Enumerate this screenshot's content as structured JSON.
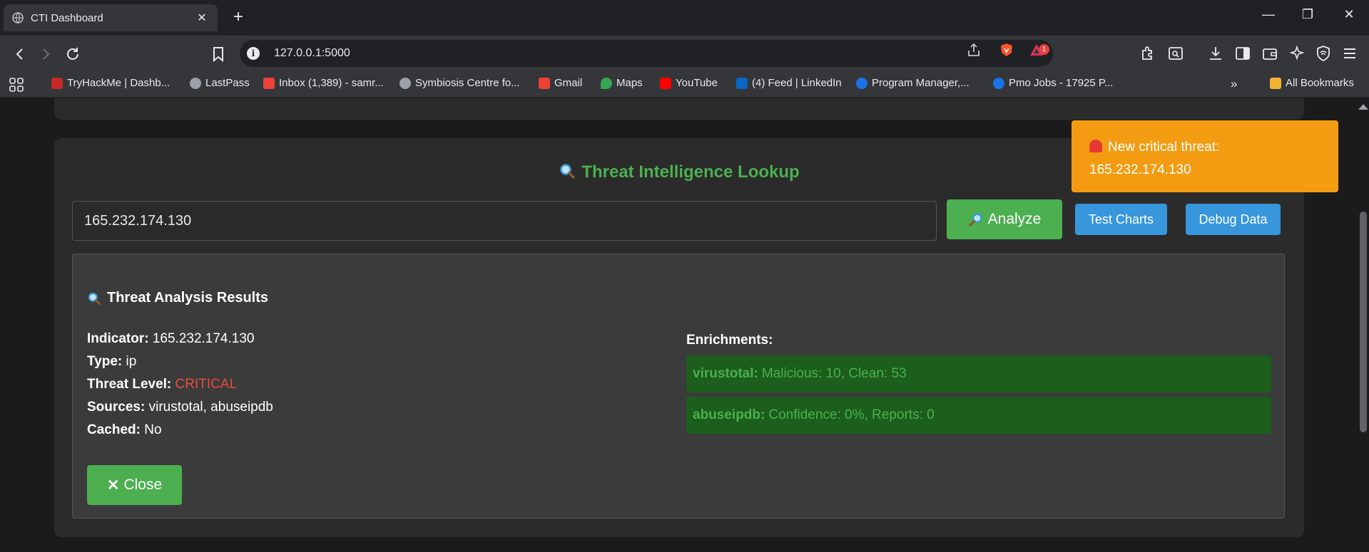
{
  "browser": {
    "tab_title": "CTI Dashboard",
    "url": "127.0.0.1:5000",
    "notification_count": "1",
    "bookmarks": [
      {
        "label": "TryHackMe | Dashb...",
        "color": "#c62828"
      },
      {
        "label": "LastPass",
        "color": "#9aa0a6"
      },
      {
        "label": "Inbox (1,389) - samr...",
        "color": "#ea4335"
      },
      {
        "label": "Symbiosis Centre fo...",
        "color": "#9aa0a6"
      },
      {
        "label": "Gmail",
        "color": "#ea4335"
      },
      {
        "label": "Maps",
        "color": "#34a853"
      },
      {
        "label": "YouTube",
        "color": "#ff0000"
      },
      {
        "label": "(4) Feed | LinkedIn",
        "color": "#0a66c2"
      },
      {
        "label": "Program Manager,...",
        "color": "#1a73e8"
      },
      {
        "label": "Pmo Jobs - 17925 P...",
        "color": "#1a73e8"
      }
    ],
    "all_bookmarks": "All Bookmarks"
  },
  "lookup": {
    "title": "Threat Intelligence Lookup",
    "input_value": "165.232.174.130",
    "analyze_label": "Analyze",
    "test_charts_label": "Test Charts",
    "debug_label": "Debug Data"
  },
  "results": {
    "title": "Threat Analysis Results",
    "indicator_label": "Indicator:",
    "indicator_value": "165.232.174.130",
    "type_label": "Type:",
    "type_value": "ip",
    "threat_label": "Threat Level:",
    "threat_value": "CRITICAL",
    "sources_label": "Sources:",
    "sources_value": "virustotal, abuseipdb",
    "cached_label": "Cached:",
    "cached_value": "No",
    "enrichments_label": "Enrichments:",
    "enrichments": [
      {
        "source": "virustotal:",
        "detail": "Malicious: 10, Clean: 53"
      },
      {
        "source": "abuseipdb:",
        "detail": "Confidence: 0%, Reports: 0"
      }
    ],
    "close_label": "Close"
  },
  "toast": {
    "line1": "New critical threat:",
    "line2": "165.232.174.130"
  },
  "colors": {
    "accent_green": "#4caf50",
    "critical_red": "#e74c3c",
    "toast_orange": "#f39c12",
    "button_blue": "#3796dc"
  }
}
